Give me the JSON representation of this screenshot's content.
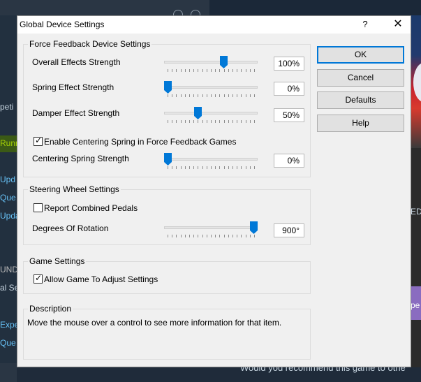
{
  "background": {
    "left_texts": [
      "peti",
      "Runn",
      "Upd",
      "Que",
      "Upda",
      "UND",
      "al Se",
      "Expe",
      "Que"
    ],
    "right_texts": [
      "ED",
      "pe"
    ],
    "bottom_text": "Would you recommend this game to othe"
  },
  "dialog": {
    "title": "Global Device Settings",
    "help_glyph": "?",
    "close_glyph": "✕",
    "ffb": {
      "group_label": "Force Feedback Device Settings",
      "overall": {
        "label": "Overall Effects Strength",
        "value": "100%",
        "level": 0.65
      },
      "spring": {
        "label": "Spring Effect Strength",
        "value": "0%",
        "level": 0.0
      },
      "damper": {
        "label": "Damper Effect Strength",
        "value": "50%",
        "level": 0.35
      },
      "centering_checkbox": {
        "label": "Enable Centering Spring in Force Feedback Games",
        "checked": true
      },
      "centering": {
        "label": "Centering Spring Strength",
        "value": "0%",
        "level": 0.0
      }
    },
    "wheel": {
      "group_label": "Steering Wheel Settings",
      "combined_pedals": {
        "label": "Report Combined Pedals",
        "checked": false
      },
      "rotation": {
        "label": "Degrees Of Rotation",
        "value": "900°",
        "level": 1.0
      }
    },
    "game": {
      "group_label": "Game Settings",
      "allow_adjust": {
        "label": "Allow Game To Adjust Settings",
        "checked": true
      }
    },
    "description": {
      "group_label": "Description",
      "text": "Move the mouse over a control to see more information for that item."
    },
    "buttons": {
      "ok": "OK",
      "cancel": "Cancel",
      "defaults": "Defaults",
      "help": "Help"
    },
    "check_glyph": "✓",
    "accent_color": "#0078d7"
  }
}
